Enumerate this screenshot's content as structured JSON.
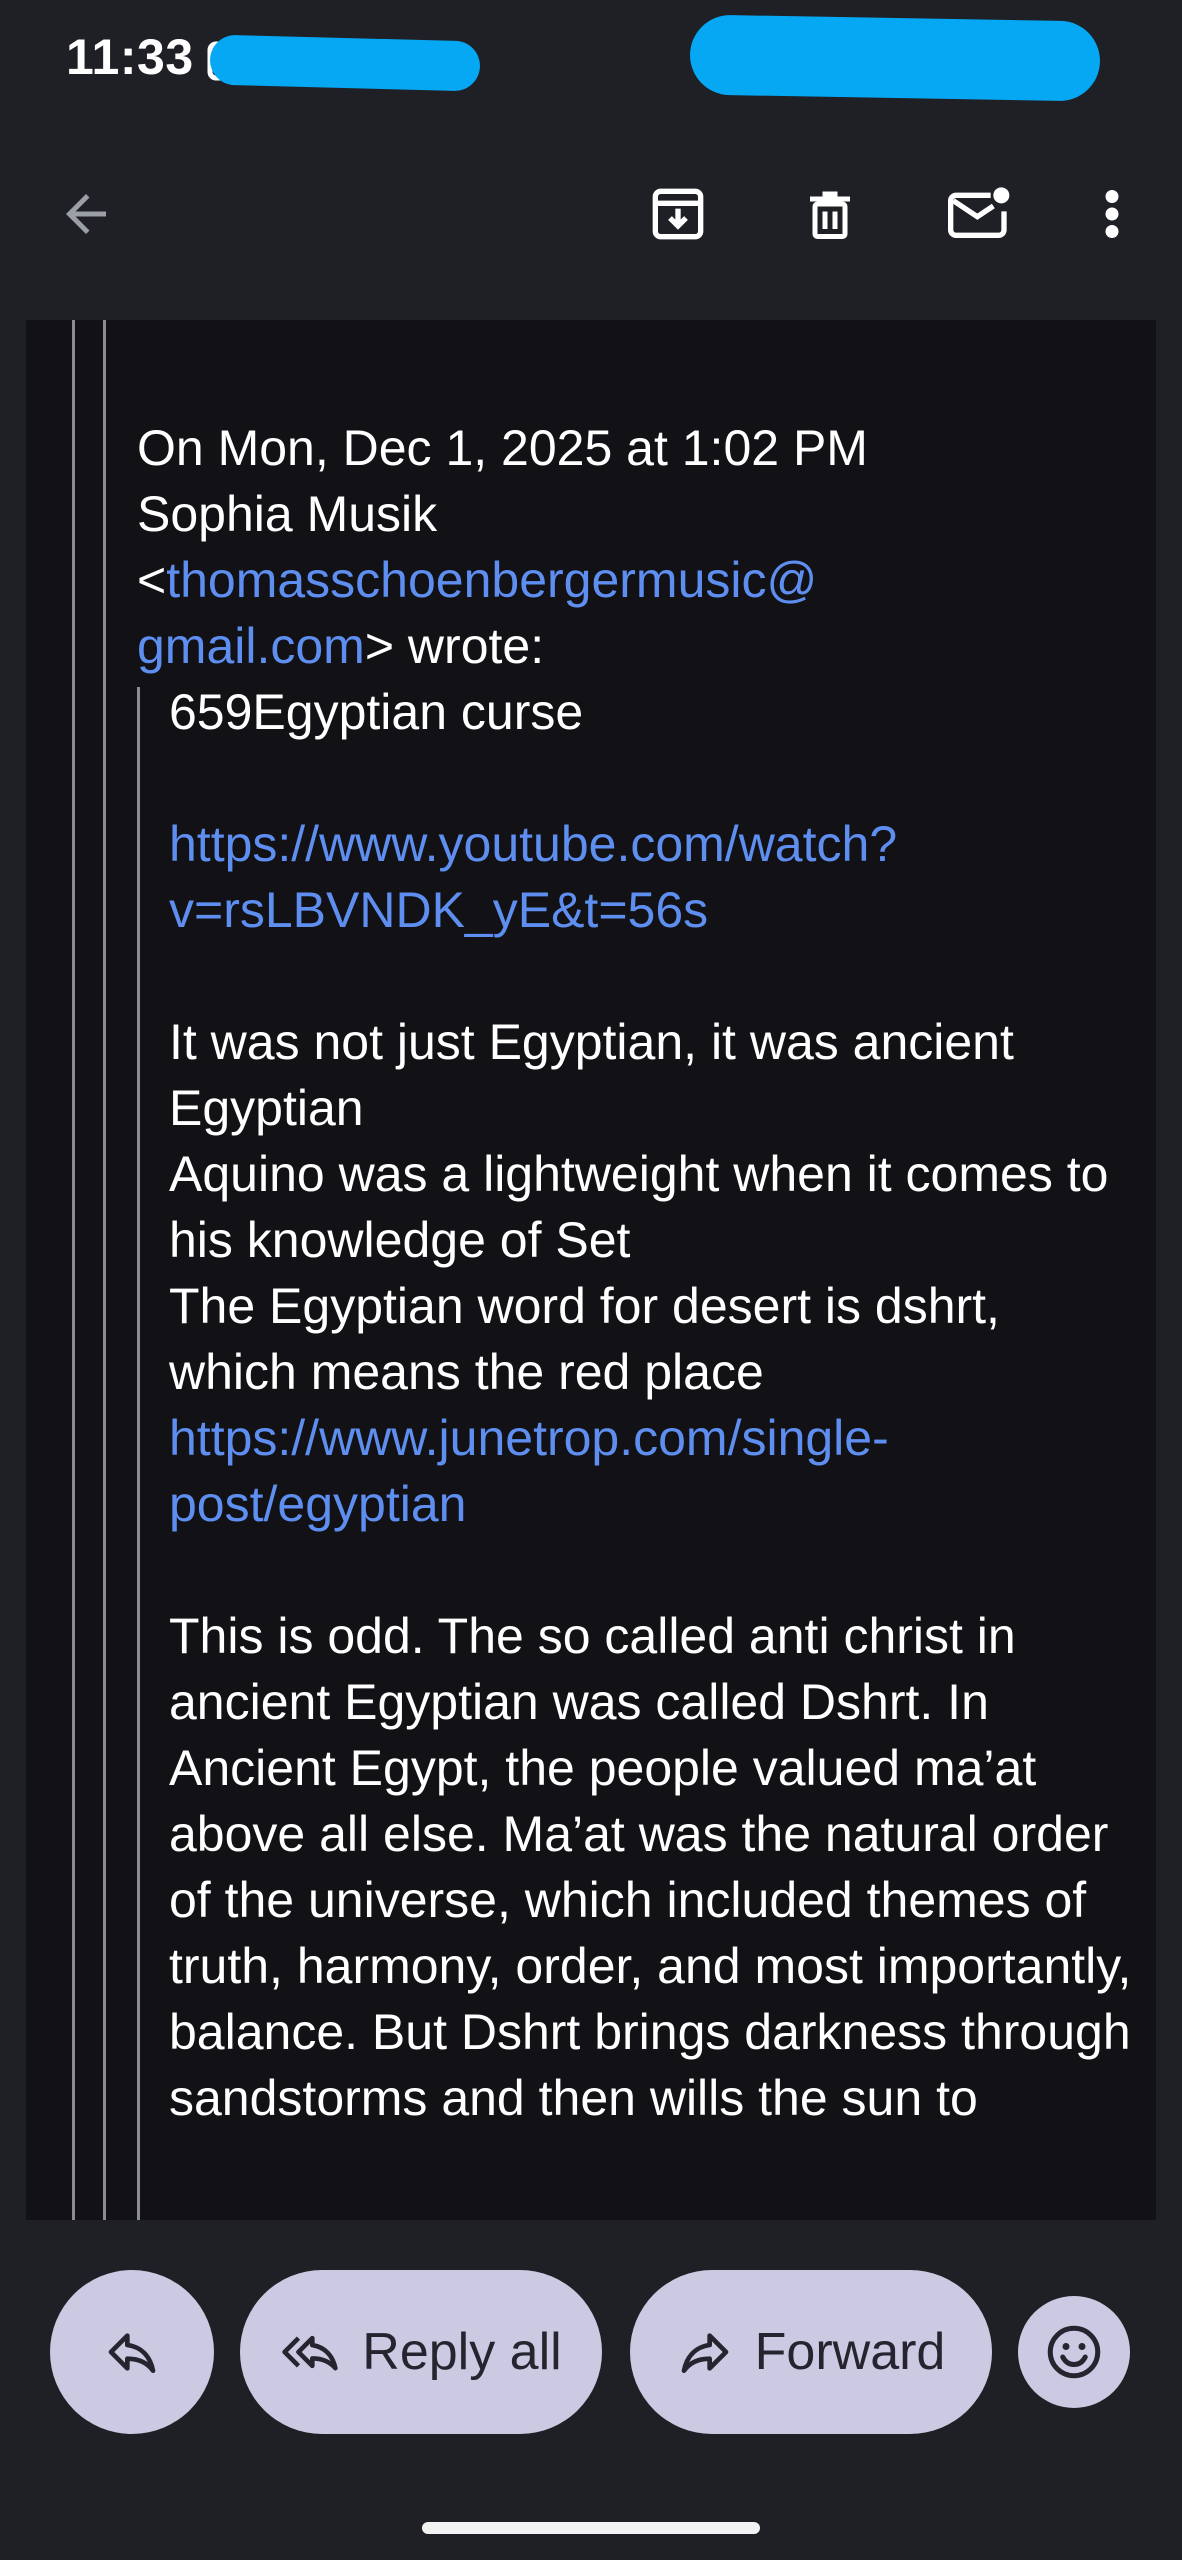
{
  "status_bar": {
    "time": "11:33"
  },
  "toolbar": {
    "back_icon": "arrow-left-icon",
    "archive_icon": "archive-icon",
    "delete_icon": "trash-icon",
    "mark_unread_icon": "mail-unread-icon",
    "more_icon": "more-vertical-icon"
  },
  "email": {
    "header_line1": "On Mon, Dec 1, 2025 at 1:02 PM",
    "header_line2": "Sophia Musik",
    "lt": "<",
    "sender_email_part1": "thomasschoenbergermusic@",
    "sender_email_part2": "gmail.com",
    "wrote": "> wrote:",
    "quote": {
      "subject": "659Egyptian curse",
      "link1_part1": "https://www.youtube.com/watch?",
      "link1_part2": "v=rsLBVNDK_yE&t=56s",
      "para1": "It was not just Egyptian, it was ancient Egyptian",
      "para2": "Aquino was a lightweight when it comes to his knowledge of Set",
      "para3": "The Egyptian word for desert is dshrt, which means the red place",
      "link2_part1": "https://www.junetrop.com/single-",
      "link2_part2": "post/egyptian",
      "para4": "This is odd. The so called anti christ in ancient Egyptian was called Dshrt. In Ancient Egypt, the people valued ma’at above all else. Ma’at was the natural order of the universe, which included themes of truth, harmony, order, and most importantly, balance. But Dshrt brings darkness through sandstorms and then wills the sun to"
    }
  },
  "actions": {
    "reply_icon": "reply-icon",
    "reply_all_icon": "reply-all-icon",
    "reply_all_label": "Reply all",
    "forward_icon": "forward-icon",
    "forward_label": "Forward",
    "emoji_icon": "emoji-icon"
  },
  "colors": {
    "background": "#1f2025",
    "content_background": "#111116",
    "link": "#5e8ff0",
    "pill": "#cccae3",
    "redaction": "#06a8f4"
  }
}
